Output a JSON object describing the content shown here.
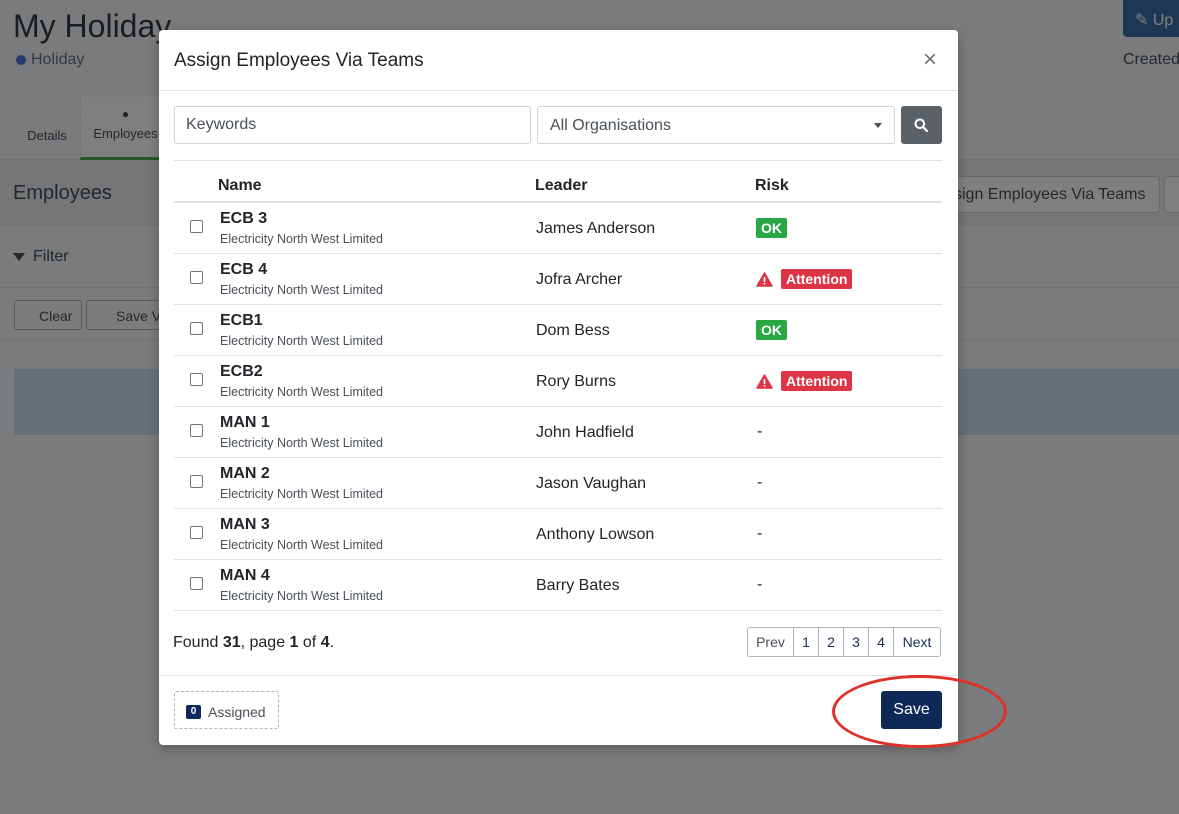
{
  "background": {
    "title": "My Holiday",
    "subtitle": "Holiday",
    "top_button": "Up",
    "created_label": "Created",
    "tabs": [
      {
        "label": "Details"
      },
      {
        "label": "Employees",
        "icon": "user-icon"
      }
    ],
    "section_title": "Employees",
    "assign_button": "sign Employees Via Teams",
    "filter_label": "Filter",
    "clear_button": "Clear",
    "save_view_button": "Save V"
  },
  "modal": {
    "title": "Assign Employees Via Teams",
    "close_glyph": "×",
    "search": {
      "placeholder": "Keywords",
      "value": ""
    },
    "organisation_select": {
      "selected": "All Organisations"
    },
    "columns": {
      "name": "Name",
      "leader": "Leader",
      "risk": "Risk"
    },
    "rows": [
      {
        "name": "ECB 3",
        "org": "Electricity North West Limited",
        "leader": "James Anderson",
        "risk": "OK",
        "risk_type": "ok"
      },
      {
        "name": "ECB 4",
        "org": "Electricity North West Limited",
        "leader": "Jofra Archer",
        "risk": "Attention",
        "risk_type": "attention"
      },
      {
        "name": "ECB1",
        "org": "Electricity North West Limited",
        "leader": "Dom Bess",
        "risk": "OK",
        "risk_type": "ok"
      },
      {
        "name": "ECB2",
        "org": "Electricity North West Limited",
        "leader": "Rory Burns",
        "risk": "Attention",
        "risk_type": "attention"
      },
      {
        "name": "MAN 1",
        "org": "Electricity North West Limited",
        "leader": "John Hadfield",
        "risk": "-",
        "risk_type": "none"
      },
      {
        "name": "MAN 2",
        "org": "Electricity North West Limited",
        "leader": "Jason Vaughan",
        "risk": "-",
        "risk_type": "none"
      },
      {
        "name": "MAN 3",
        "org": "Electricity North West Limited",
        "leader": "Anthony Lowson",
        "risk": "-",
        "risk_type": "none"
      },
      {
        "name": "MAN 4",
        "org": "Electricity North West Limited",
        "leader": "Barry Bates",
        "risk": "-",
        "risk_type": "none"
      }
    ],
    "found": {
      "prefix": "Found ",
      "count": "31",
      "mid": ", page ",
      "page": "1",
      "of": " of ",
      "total_pages": "4",
      "suffix": "."
    },
    "pagination": {
      "prev": "Prev",
      "pages": [
        "1",
        "2",
        "3",
        "4"
      ],
      "next": "Next"
    },
    "assigned": {
      "count": "0",
      "label": "Assigned"
    },
    "save_label": "Save"
  },
  "colors": {
    "primary_navy": "#0e2858",
    "ok_green": "#28a745",
    "attention_red": "#dc3545",
    "highlight_red": "#e0302a"
  }
}
